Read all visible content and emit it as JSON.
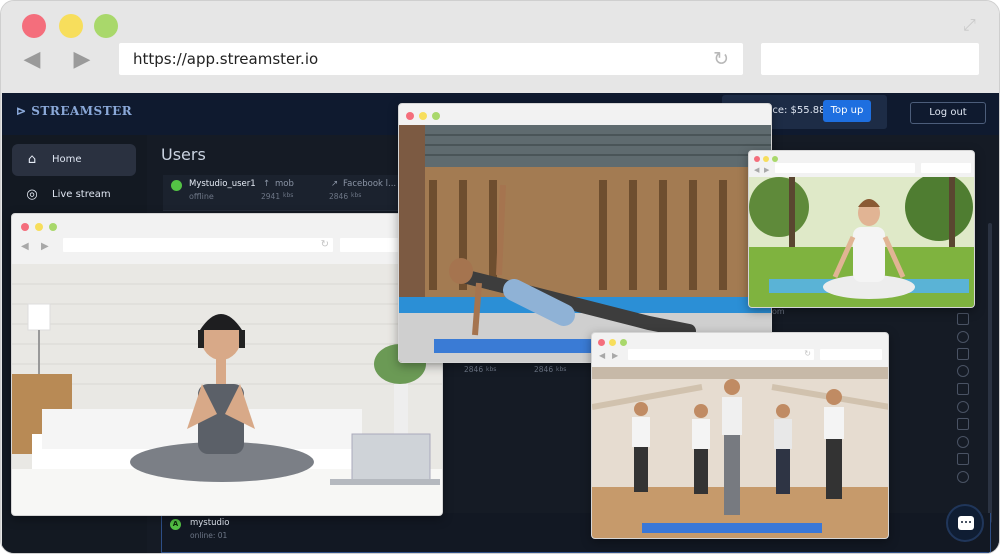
{
  "browser": {
    "url": "https://app.streamster.io"
  },
  "app": {
    "logo": "STREAMSTER",
    "balance_label": "nce: $55.88",
    "topup_label": "Top up",
    "logout_label": "Log out"
  },
  "sidebar": {
    "items": [
      {
        "label": "Home",
        "icon": "home-icon"
      },
      {
        "label": "Live stream",
        "icon": "broadcast-icon"
      }
    ]
  },
  "main": {
    "title": "Users",
    "first_user": {
      "name": "Mystudio_user1",
      "state": "offline",
      "col1": "mob",
      "col1_sub": "2941",
      "col1_sub_unit": "kbs",
      "col2": "Facebook l...",
      "col2_sub": "2846",
      "col2_sub_unit": "kbs"
    },
    "mid_cells": [
      "2846",
      "kbs",
      "2846",
      "kbs"
    ],
    "side_text": "om",
    "last_user": {
      "badge": "A",
      "name": "mystudio",
      "state": "online: 01"
    }
  },
  "colors": {
    "accent": "#1e6fe0",
    "online": "#54c245",
    "app_bg": "#141a24"
  }
}
